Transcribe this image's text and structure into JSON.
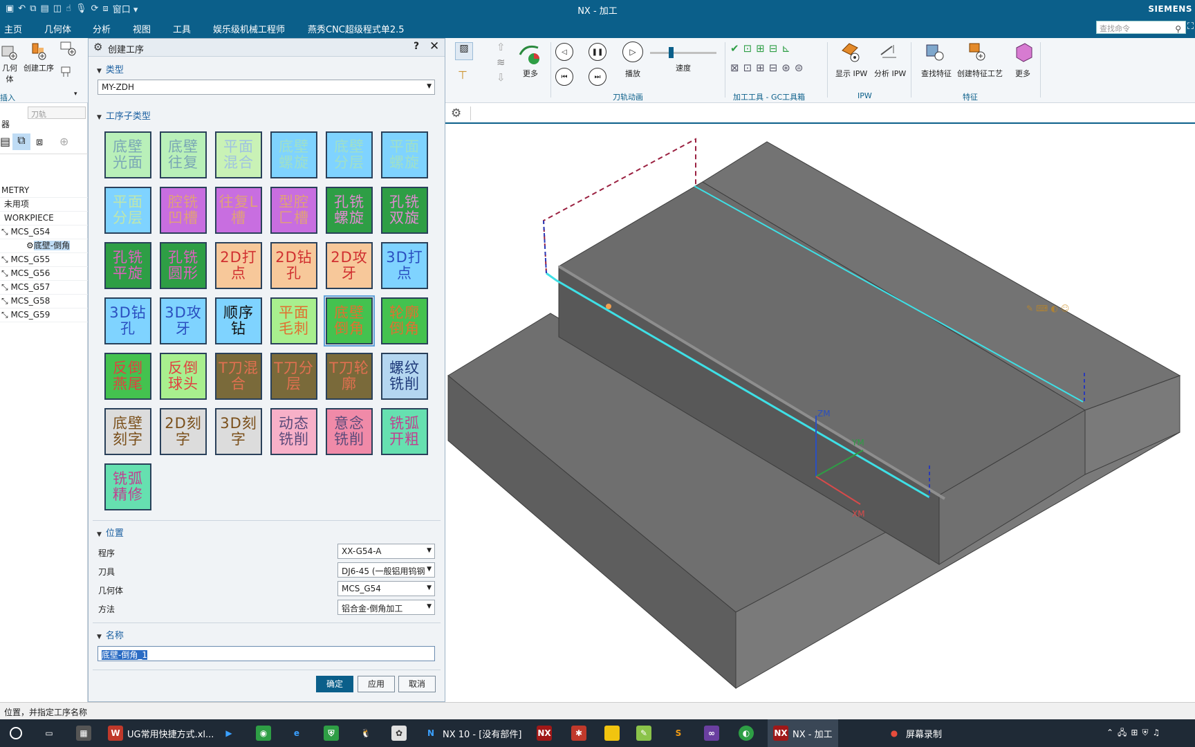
{
  "window": {
    "title": "NX - 加工",
    "brand": "SIEMENS",
    "qat_window_label": "窗口"
  },
  "menu": {
    "items": [
      "主页",
      "几何体",
      "分析",
      "视图",
      "工具",
      "娱乐级机械工程师",
      "燕秀CNC超级程式单2.5"
    ],
    "active_index": 0,
    "search_placeholder": "查找命令"
  },
  "left_ribbon": {
    "btn_geometry": "几何体",
    "btn_create_op": "创建工序",
    "group": "插入"
  },
  "navigator": {
    "filter_placeholder": "刀轨",
    "header_label": "器",
    "rows": [
      "METRY",
      "未用项",
      "WORKPIECE",
      "MCS_G54",
      "底壁-倒角",
      "MCS_G55",
      "MCS_G56",
      "MCS_G57",
      "MCS_G58",
      "MCS_G59"
    ]
  },
  "dialog": {
    "title": "创建工序",
    "help": "?",
    "close": "✕",
    "type_section": "类型",
    "type_value": "MY-ZDH",
    "subtype_section": "工序子类型",
    "subtypes": [
      {
        "text": "底壁光面",
        "bg": "#b9f0b9",
        "fg": "#7aa7b5"
      },
      {
        "text": "底壁往复",
        "bg": "#b9f0b9",
        "fg": "#7aa7b5"
      },
      {
        "text": "平面混合",
        "bg": "#c9f2b6",
        "fg": "#9fc3e0"
      },
      {
        "text": "底壁螺旋",
        "bg": "#7fd3ff",
        "fg": "#9fe0c8"
      },
      {
        "text": "底壁分层",
        "bg": "#7fd3ff",
        "fg": "#9fe0c8"
      },
      {
        "text": "平面螺旋",
        "bg": "#7fd3ff",
        "fg": "#9fe0c8"
      },
      {
        "text": "平面分层",
        "bg": "#7fd3ff",
        "fg": "#bfe7ad"
      },
      {
        "text": "腔铣凹槽",
        "bg": "#c86ee0",
        "fg": "#e0a07a"
      },
      {
        "text": "往复L槽",
        "bg": "#c86ee0",
        "fg": "#e0a07a"
      },
      {
        "text": "型腔匚槽",
        "bg": "#c86ee0",
        "fg": "#e0a07a"
      },
      {
        "text": "孔铣螺旋",
        "bg": "#2e9e45",
        "fg": "#e08ad0"
      },
      {
        "text": "孔铣双旋",
        "bg": "#2e9e45",
        "fg": "#e08ad0"
      },
      {
        "text": "孔铣平旋",
        "bg": "#2e9e45",
        "fg": "#e060c0"
      },
      {
        "text": "孔铣圆形",
        "bg": "#2e9e45",
        "fg": "#e060c0"
      },
      {
        "text": "2D打点",
        "bg": "#f7c89a",
        "fg": "#d03030"
      },
      {
        "text": "2D钻孔",
        "bg": "#f7c89a",
        "fg": "#d03030"
      },
      {
        "text": "2D攻牙",
        "bg": "#f7c89a",
        "fg": "#d03030"
      },
      {
        "text": "3D打点",
        "bg": "#7fd3ff",
        "fg": "#2a4fc0"
      },
      {
        "text": "3D钻孔",
        "bg": "#7fd3ff",
        "fg": "#2a4fc0"
      },
      {
        "text": "3D攻牙",
        "bg": "#7fd3ff",
        "fg": "#2a4fc0"
      },
      {
        "text": "顺序钻",
        "bg": "#7fd3ff",
        "fg": "#111111"
      },
      {
        "text": "平面毛刺",
        "bg": "#a8ef8e",
        "fg": "#e07030"
      },
      {
        "text": "底壁倒角",
        "bg": "#44c24f",
        "fg": "#e07030"
      },
      {
        "text": "轮廓倒角",
        "bg": "#44c24f",
        "fg": "#e07030"
      },
      {
        "text": "反倒燕尾",
        "bg": "#44c24f",
        "fg": "#e04040"
      },
      {
        "text": "反倒球头",
        "bg": "#a8ef8e",
        "fg": "#e04040"
      },
      {
        "text": "T刀混合",
        "bg": "#7a6a3a",
        "fg": "#e07050"
      },
      {
        "text": "T刀分层",
        "bg": "#7a6a3a",
        "fg": "#e07050"
      },
      {
        "text": "T刀轮廓",
        "bg": "#7a6a3a",
        "fg": "#e07050"
      },
      {
        "text": "螺纹铣削",
        "bg": "#b4d6f0",
        "fg": "#1f3a7a"
      },
      {
        "text": "底壁刻字",
        "bg": "#dcdcdc",
        "fg": "#7a4f1a"
      },
      {
        "text": "2D刻字",
        "bg": "#dcdcdc",
        "fg": "#7a4f1a"
      },
      {
        "text": "3D刻字",
        "bg": "#dcdcdc",
        "fg": "#7a4f1a"
      },
      {
        "text": "动态铣削",
        "bg": "#f7b0c8",
        "fg": "#5a4a7a"
      },
      {
        "text": "意念铣削",
        "bg": "#f08aa8",
        "fg": "#5a4a7a"
      },
      {
        "text": "铣弧开粗",
        "bg": "#66e0b0",
        "fg": "#c04090"
      },
      {
        "text": "铣弧精修",
        "bg": "#66e0b0",
        "fg": "#c04090"
      }
    ],
    "selected_subtype_index": 22,
    "position_section": "位置",
    "position": {
      "program_label": "程序",
      "program_value": "XX-G54-A",
      "tool_label": "刀具",
      "tool_value": "DJ6-45 (一般铝用钨钢",
      "geometry_label": "几何体",
      "geometry_value": "MCS_G54",
      "method_label": "方法",
      "method_value": "铝合金-倒角加工"
    },
    "name_section": "名称",
    "name_value": "底壁-倒角_1",
    "ok": "确定",
    "apply": "应用",
    "cancel": "取消"
  },
  "right_ribbon": {
    "more1": "更多",
    "play": "播放",
    "speed": "速度",
    "speed_level": 0.3,
    "group_animation": "刀轨动画",
    "group_gc": "加工工具 - GC工具箱",
    "show_ipw": "显示 IPW",
    "analyze_ipw": "分析 IPW",
    "group_ipw": "IPW",
    "find_feature": "查找特征",
    "create_feature_process": "创建特征工艺",
    "more2": "更多",
    "group_feature": "特征"
  },
  "viewport": {
    "axis_zm": "ZM",
    "axis_ym": "YM",
    "axis_xm": "XM"
  },
  "status": {
    "text": "位置，并指定工序名称"
  },
  "taskbar": {
    "excel_label": "UG常用快捷方式.xl...",
    "nx10_label": "NX 10 - [没有部件]",
    "nx_label": "NX - 加工",
    "rec_label": "屏幕录制"
  },
  "colors": {
    "brand_blue": "#0b5f8a",
    "toolpath": "#3ee0e6",
    "model": "#6b6b6b"
  }
}
